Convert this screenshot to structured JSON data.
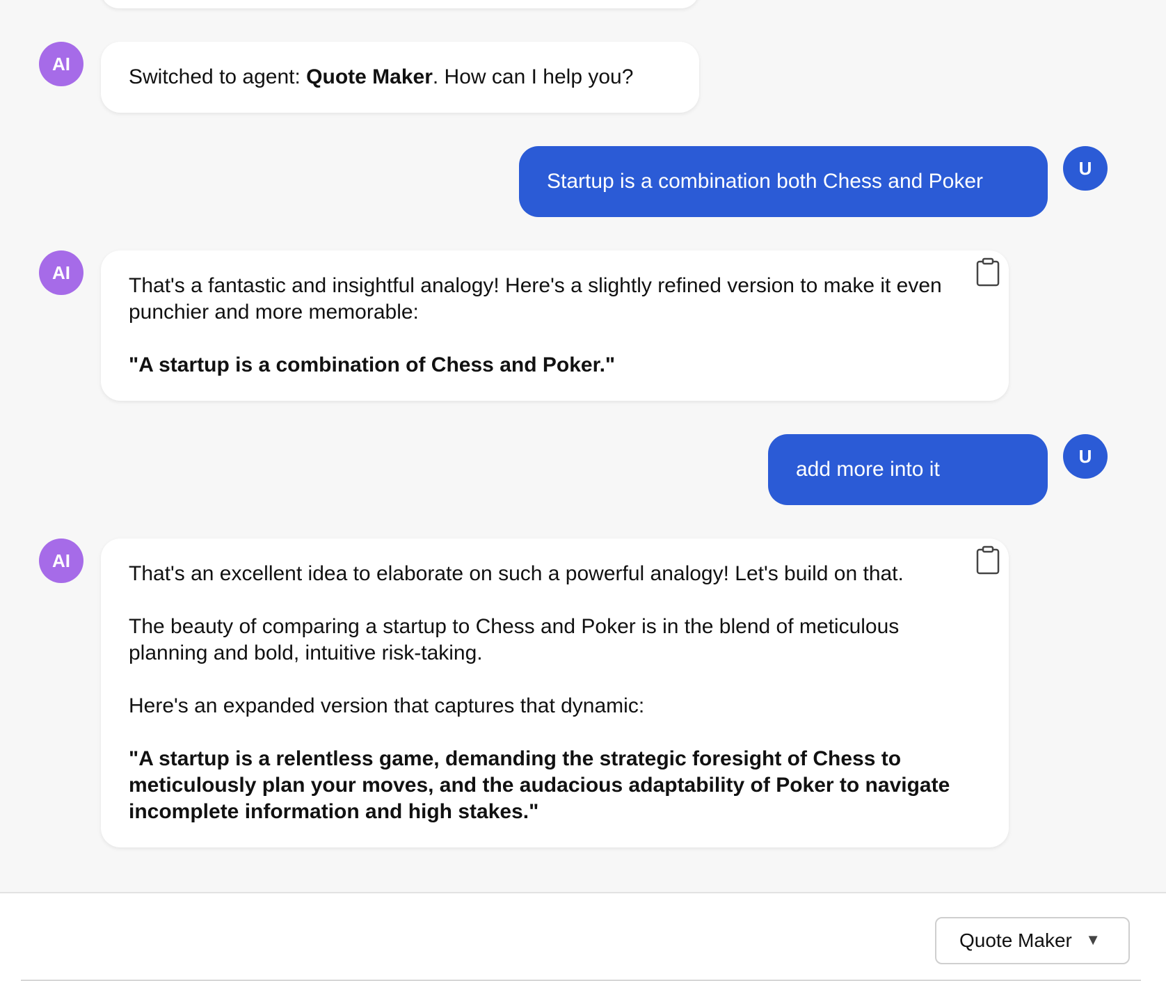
{
  "avatars": {
    "ai": "AI",
    "user": "U"
  },
  "messages": [
    {
      "role": "ai",
      "parts": [
        {
          "prefix": "Switched to agent: ",
          "bold": "Quote Maker",
          "suffix": ". How can I help you?"
        }
      ]
    },
    {
      "role": "user",
      "text": "Startup is a combination both Chess and Poker"
    },
    {
      "role": "ai",
      "paragraphs": [
        {
          "text": "That's a fantastic and insightful analogy! Here's a slightly refined version to make it even punchier and more memorable:",
          "bold": false
        },
        {
          "text": "\"A startup is a combination of Chess and Poker.\"",
          "bold": true
        }
      ],
      "copy_icon": "clipboard-icon"
    },
    {
      "role": "user",
      "text": "add more into it"
    },
    {
      "role": "ai",
      "paragraphs": [
        {
          "text": "That's an excellent idea to elaborate on such a powerful analogy! Let's build on that.",
          "bold": false
        },
        {
          "text": "The beauty of comparing a startup to Chess and Poker is in the blend of meticulous planning and bold, intuitive risk-taking.",
          "bold": false
        },
        {
          "text": "Here's an expanded version that captures that dynamic:",
          "bold": false
        },
        {
          "text": "\"A startup is a relentless game, demanding the strategic foresight of Chess to meticulously plan your moves, and the audacious adaptability of Poker to navigate incomplete information and high stakes.\"",
          "bold": true
        }
      ],
      "copy_icon": "clipboard-icon"
    }
  ],
  "footer": {
    "agent_select": {
      "value": "Quote Maker",
      "arrow": "▼",
      "icon": "dropdown-arrow-icon"
    }
  },
  "colors": {
    "background": "#f7f7f7",
    "ai_avatar": "#a66be8",
    "user_bubble": "#2b5bd6",
    "ai_bubble": "#ffffff"
  }
}
